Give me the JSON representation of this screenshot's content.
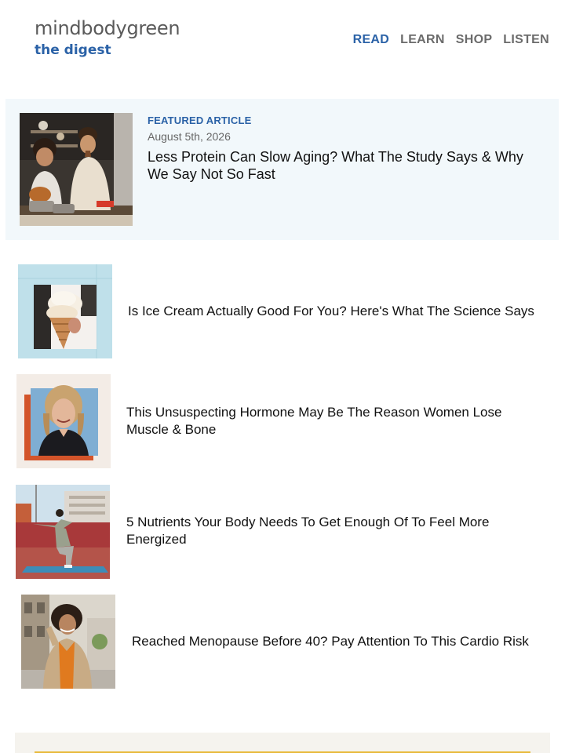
{
  "brand": {
    "name": "mindbodygreen",
    "subtitle": "the digest"
  },
  "nav": {
    "items": [
      {
        "label": "READ",
        "active": true
      },
      {
        "label": "LEARN",
        "active": false
      },
      {
        "label": "SHOP",
        "active": false
      },
      {
        "label": "LISTEN",
        "active": false
      }
    ]
  },
  "featured": {
    "kicker": "FEATURED ARTICLE",
    "date": "August 5th, 2026",
    "title": "Less Protein Can Slow Aging? What The Study Says & Why We Say Not So Fast",
    "image": "couple-cooking-kitchen-photo"
  },
  "articles": [
    {
      "title": "Is Ice Cream Actually Good For You? Here's What The Science Says",
      "image": "ice-cream-cone-photo"
    },
    {
      "title": "This Unsuspecting Hormone May Be The Reason Women Lose Muscle & Bone",
      "image": "smiling-woman-portrait-photo"
    },
    {
      "title": "5 Nutrients Your Body Needs To Get Enough Of To Feel More Energized",
      "image": "woman-squatting-exercise-photo"
    },
    {
      "title": "Reached Menopause Before 40? Pay Attention To This Cardio Risk",
      "image": "woman-city-street-photo"
    }
  ],
  "colors": {
    "accent": "#2b62a7",
    "featured_bg": "#f2f8fb",
    "footer_bg": "#f5f3ee",
    "footer_rule": "#e8b93a"
  }
}
